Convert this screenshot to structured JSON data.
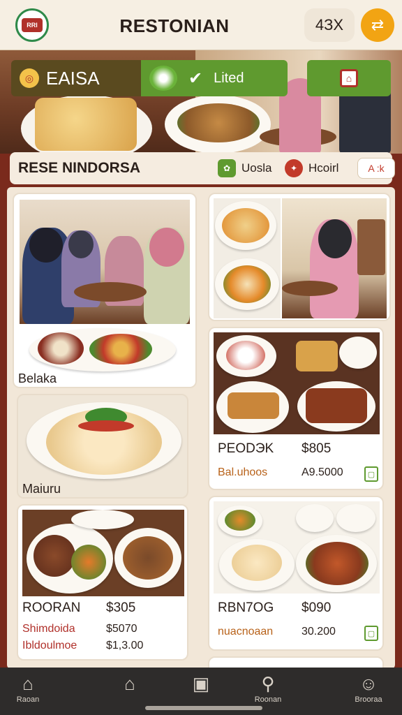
{
  "header": {
    "app_title": "RESTONIAN",
    "logo_text": "RRI",
    "pill_label": "4ЗX",
    "action_icon": "share-icon"
  },
  "hero": {
    "bar_left_label": "EAISA",
    "bar_mid_label": "Lited"
  },
  "section": {
    "title": "RESE NINDORSA",
    "chip_1_label": "Uosla",
    "chip_2_label": "Hcoirl",
    "tag_label": "A :k",
    "colors": {
      "chip_1": "#5f9a2f",
      "chip_2": "#c23a2a"
    }
  },
  "cards": {
    "c1": {
      "label": "Belaka"
    },
    "c2": {
      "label": "Maiuru"
    },
    "c3": {
      "name": "ROORAN",
      "price": "$305",
      "sub1": "Shimdoida",
      "sub1_price": "$5070",
      "sub2": "Ibldoulmoe",
      "sub2_price": "$1,3.00"
    },
    "c4": {
      "name": "PEODЭK",
      "price": "$805",
      "sub": "Bal.uhoos",
      "sub_price": "A9.5000"
    },
    "c5": {
      "name": "RBN7OG",
      "price": "$090",
      "sub": "nuacnoaan",
      "sub_price": "30.200"
    }
  },
  "nav": {
    "items": [
      {
        "label": "Raoan",
        "icon": "home-filled-icon"
      },
      {
        "label": "",
        "icon": "home-outline-icon"
      },
      {
        "label": "",
        "icon": "menu-card-icon"
      },
      {
        "label": "Roonan",
        "icon": "search-icon"
      },
      {
        "label": "Brooraa",
        "icon": "profile-icon"
      }
    ]
  }
}
